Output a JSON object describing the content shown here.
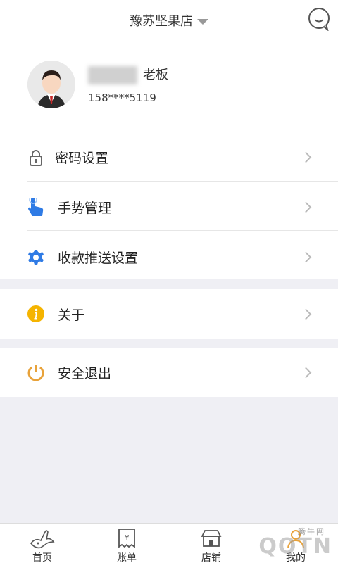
{
  "header": {
    "store_name": "豫苏坚果店"
  },
  "profile": {
    "name_suffix": "老板",
    "phone": "158****5119"
  },
  "menu": {
    "password": "密码设置",
    "gesture": "手势管理",
    "push": "收款推送设置",
    "about": "关于",
    "logout": "安全退出"
  },
  "tabs": {
    "home": "首页",
    "bills": "账单",
    "shop": "店铺",
    "mine": "我的"
  },
  "watermark": {
    "text": "QQTN",
    "sub": "腾牛网"
  },
  "colors": {
    "gesture_icon": "#2f7be5",
    "push_icon": "#2f7be5",
    "about_icon": "#f5b400",
    "logout_icon": "#e8a23a"
  }
}
